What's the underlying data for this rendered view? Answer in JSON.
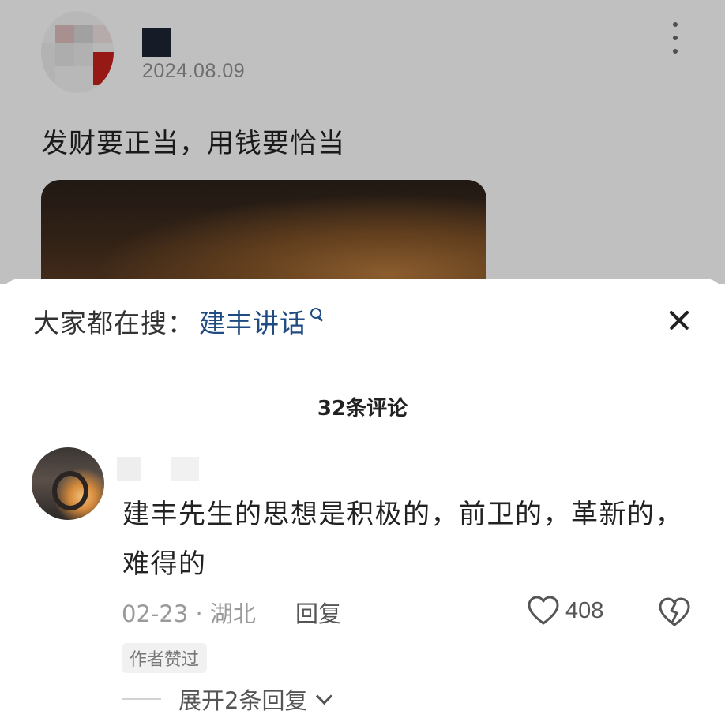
{
  "post": {
    "date": "2024.08.09",
    "text": "发财要正当，用钱要恰当",
    "more_icon": "more-vertical-icon"
  },
  "sheet": {
    "search_label": "大家都在搜：",
    "search_term": "建丰讲话",
    "close_icon": "close-icon",
    "comment_count": "32条评论"
  },
  "comment": {
    "text": "建丰先生的思想是积极的，前卫的，革新的，难得的",
    "meta": "02-23 · 湖北",
    "reply_label": "回复",
    "like_count": "408",
    "author_badge": "作者赞过",
    "expand_label": "展开2条回复"
  },
  "colors": {
    "link_blue": "#1f4a82",
    "text_main": "#222222",
    "text_muted": "#9a9a9a"
  }
}
